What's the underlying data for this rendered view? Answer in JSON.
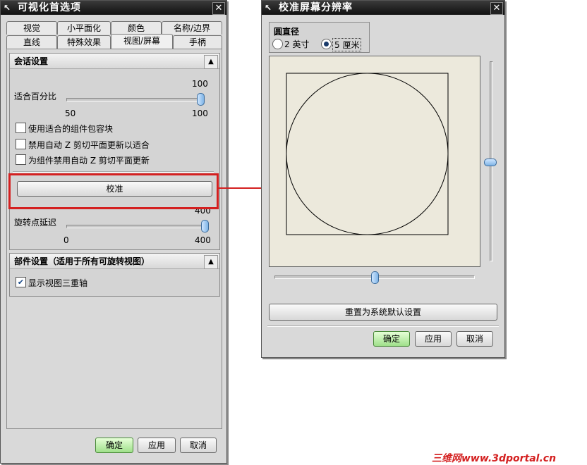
{
  "left_dialog": {
    "title": "可视化首选项",
    "tabs_row1": [
      "视觉",
      "小平面化",
      "颜色",
      "名称/边界"
    ],
    "tabs_row2": [
      "直线",
      "特殊效果",
      "视图/屏幕",
      "手柄"
    ],
    "active_tab": "视图/屏幕",
    "session_section": {
      "header": "会话设置",
      "fit_percent": {
        "label": "适合百分比",
        "value": "100",
        "min": "50",
        "max": "100",
        "fraction": 1.0
      },
      "checkboxes": [
        {
          "label": "使用适合的组件包容块",
          "checked": false
        },
        {
          "label": "禁用自动 Z 剪切平面更新以适合",
          "checked": false
        },
        {
          "label": "为组件禁用自动 Z 剪切平面更新",
          "checked": false
        }
      ],
      "calibrate_button": "校准",
      "rotation_delay": {
        "label": "旋转点延迟",
        "value": "400",
        "min": "0",
        "max": "400",
        "fraction": 1.0
      }
    },
    "part_section": {
      "header": "部件设置（适用于所有可旋转视图）",
      "checkbox": {
        "label": "显示视图三重轴",
        "checked": true
      }
    },
    "buttons": {
      "ok": "确定",
      "apply": "应用",
      "cancel": "取消"
    }
  },
  "right_dialog": {
    "title": "校准屏幕分辨率",
    "diameter_group": {
      "label": "圆直径",
      "options": [
        {
          "label": "2 英寸",
          "selected": false
        },
        {
          "label": "5 厘米",
          "selected": true
        }
      ]
    },
    "reset_button": "重置为系统默认设置",
    "buttons": {
      "ok": "确定",
      "apply": "应用",
      "cancel": "取消"
    }
  },
  "watermark": "三维网www.3dportal.cn",
  "colors": {
    "highlight": "#d42020",
    "ok_button": "#9fe08a",
    "canvas_bg": "#ece9dc"
  },
  "icons": {
    "title": "wrench-icon",
    "close": "close-icon",
    "collapse": "chevron-up-icon"
  }
}
